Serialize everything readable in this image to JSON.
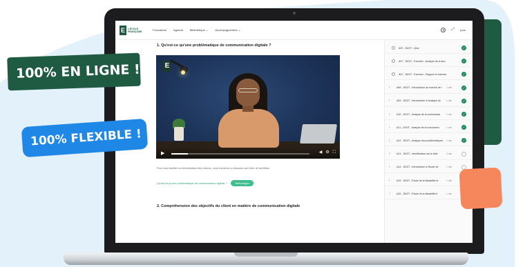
{
  "badges": {
    "online": "100% EN LIGNE !",
    "flexible": "100% FLEXIBLE !"
  },
  "topbar": {
    "logo_mark": "E",
    "logo_text": "L'ÉCOLE FRANÇAISE",
    "nav": [
      "Formations",
      "Agenda",
      "Bibliothèque",
      "Accompagnement"
    ],
    "user_label": "Ipdo"
  },
  "content": {
    "question_title": "1. Qu'est-ce qu'une problématique de communication digitale ?",
    "video_logo": "E",
    "progress": 0.12,
    "paragraph": "Pour vous faciliter la mémorisation des notions, nous trouverez ci-dessous une fiche de synthèse.",
    "download_link": "Qu'est-ce qu'une problématique de communication digitale ?",
    "download_button": "Télécharger",
    "next_section_title": "2. Compréhension des objectifs du client en matière de communication digitale"
  },
  "sidebar": {
    "items": [
      {
        "label": "A07 - DIGIT - Quiz",
        "time": "",
        "done": true,
        "type": "radio"
      },
      {
        "label": "A07 - DIGIT - Exercice : Analyse de la stra",
        "time": "",
        "done": true,
        "type": "radio"
      },
      {
        "label": "A07 - DIGIT - Exercice : Rapport et informa",
        "time": "",
        "done": true,
        "type": "radio"
      },
      {
        "label": "A08 - DIGIT - Introduction au marché de l",
        "time": "1 min",
        "done": true,
        "type": "chevron"
      },
      {
        "label": "A09 - DIGIT - Introduction à l'analyse du",
        "time": "1 min",
        "done": true,
        "type": "chevron"
      },
      {
        "label": "A10 - DIGIT - Analyse de la communica",
        "time": "1 min",
        "done": true,
        "type": "chevron"
      },
      {
        "label": "A11 - DIGIT - Analyse de la concurrenc",
        "time": "1 min",
        "done": true,
        "type": "chevron"
      },
      {
        "label": "A12 - DIGIT - Analyse des problèmatiques",
        "time": "1 min",
        "done": true,
        "type": "chevron"
      },
      {
        "label": "A13 - DIGIT - Identification de la cible",
        "time": "4 min",
        "done": false,
        "type": "chevron"
      },
      {
        "label": "A14 - DIGIT - Introduction à l'étude de",
        "time": "1 min",
        "done": false,
        "type": "chevron"
      },
      {
        "label": "A15 - DIGIT - Étude de la faisabilité te",
        "time": "1 min",
        "done": false,
        "type": "chevron"
      },
      {
        "label": "A16 - DIGIT - Étude de la faisabilité fi",
        "time": "1 min",
        "done": false,
        "type": "chevron"
      }
    ]
  },
  "colors": {
    "brand_green": "#1f5a43",
    "accent_blue": "#1f87e6",
    "accent_orange": "#f6875d",
    "success_green": "#3fbf8f"
  }
}
